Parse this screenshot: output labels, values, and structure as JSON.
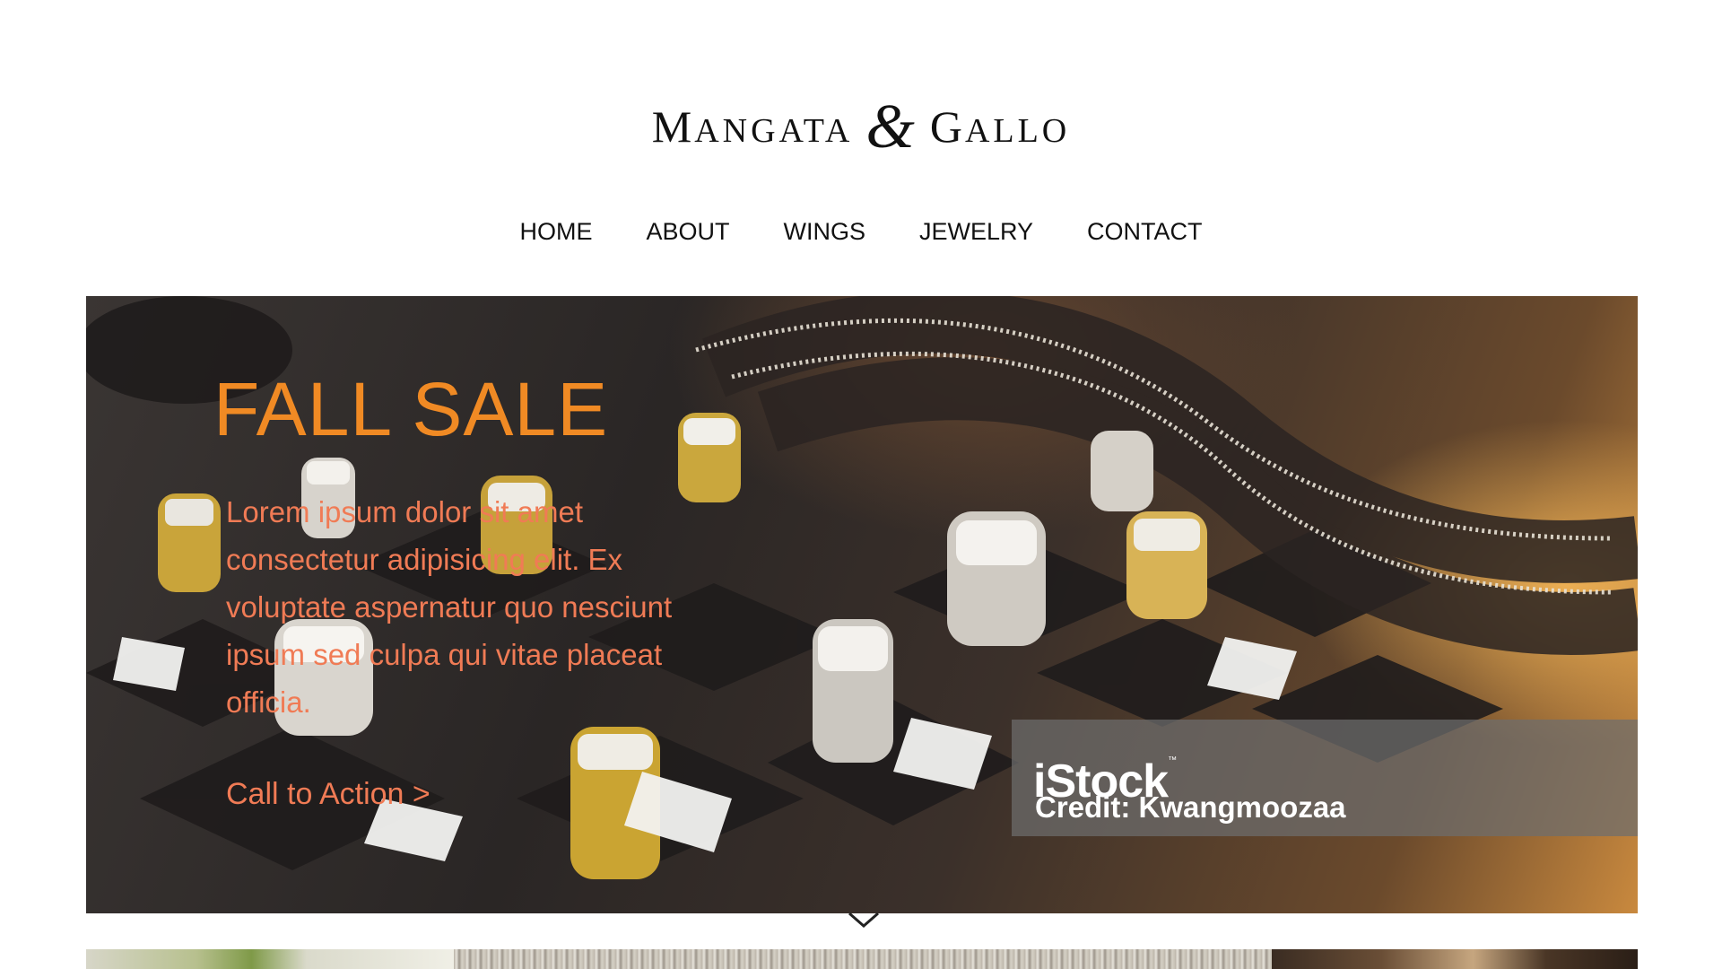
{
  "header": {
    "logo_part1_cap": "M",
    "logo_part1_rest": "ANGATA",
    "logo_amp": "&",
    "logo_part2_cap": "G",
    "logo_part2_rest": "ALLO"
  },
  "nav": {
    "items": [
      {
        "label": "HOME"
      },
      {
        "label": "ABOUT"
      },
      {
        "label": "WINGS"
      },
      {
        "label": "JEWELRY"
      },
      {
        "label": "CONTACT"
      }
    ]
  },
  "hero": {
    "title": "FALL SALE",
    "body": "Lorem ipsum dolor sit amet consectetur adipisicing elit. Ex voluptate aspernatur quo nesciunt ipsum sed culpa qui vitae placeat officia.",
    "cta_label": "Call to Action >",
    "watermark_logo": "iStock",
    "watermark_tm": "™",
    "watermark_credit": "Credit: Kwangmoozaa"
  },
  "colors": {
    "title": "#f08a24",
    "body_text": "#f07b55",
    "nav_text": "#111111"
  },
  "icons": {
    "scroll_down": "chevron-down-icon"
  }
}
